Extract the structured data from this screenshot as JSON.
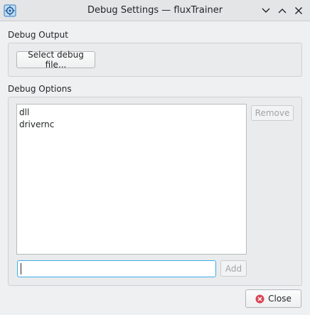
{
  "window": {
    "title": "Debug Settings — fluxTrainer",
    "icon": "gear-app-icon"
  },
  "debug_output": {
    "label": "Debug Output",
    "select_button": "Select debug file..."
  },
  "debug_options": {
    "label": "Debug Options",
    "items": [
      {
        "label": "dll"
      },
      {
        "label": "drivernc"
      }
    ],
    "remove_button": "Remove",
    "add_button": "Add",
    "input_value": ""
  },
  "footer": {
    "close_button": "Close"
  },
  "colors": {
    "accent": "#3daee9",
    "close_icon": "#da4453"
  }
}
